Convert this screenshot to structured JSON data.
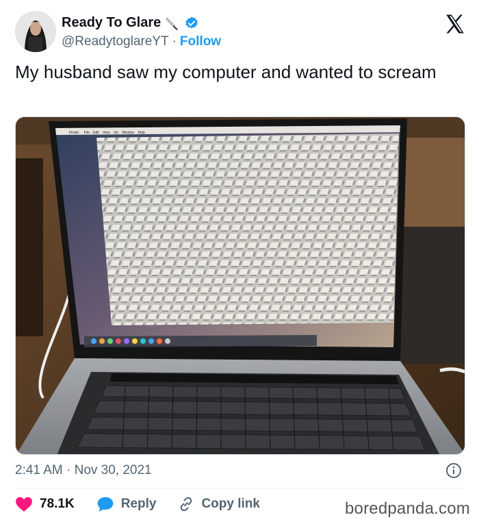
{
  "author": {
    "display_name": "Ready To Glare",
    "handle": "@ReadytoglareYT",
    "separator": "·",
    "follow_label": "Follow",
    "name_emoji_icon": "knife-icon",
    "verified_icon": "verified-badge-icon"
  },
  "tweet": {
    "text": "My husband saw my computer and wanted to scream",
    "timestamp": "2:41 AM · Nov 30, 2021"
  },
  "media": {
    "menu_bar": [
      "Finder",
      "File",
      "Edit",
      "View",
      "Go",
      "Window",
      "Help"
    ]
  },
  "actions": {
    "likes_count": "78.1K",
    "reply_label": "Reply",
    "copy_link_label": "Copy link"
  },
  "watermark": "boredpanda.com",
  "colors": {
    "like_red": "#f91880",
    "reply_blue": "#1d9bf0",
    "verified_blue": "#1d9bf0",
    "secondary_text": "#536471"
  }
}
